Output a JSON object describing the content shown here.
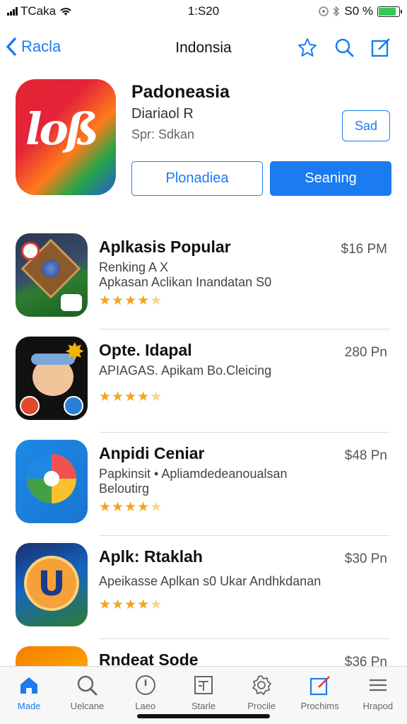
{
  "status_bar": {
    "carrier": "TCaka",
    "time": "1:S20",
    "battery": "S0 %"
  },
  "nav": {
    "back_label": "Racla",
    "title": "Indonsia"
  },
  "hero": {
    "icon_text": "loß",
    "name": "Padoneasia",
    "developer": "Diariaol R",
    "subtitle": "Spr: Sdkan",
    "get_label": "Sad",
    "outline_button": "Plonadiea",
    "filled_button": "Seaning"
  },
  "apps": [
    {
      "name": "Aplkasis Popular",
      "line1": "Renking A X",
      "line2": "Apkasan Aclikan Inandatan S0",
      "price": "$16 PM",
      "rating": 4
    },
    {
      "name": "Opte. Idapal",
      "line1": "APIAGAS. Apikam Bo.Cleicing",
      "line2": "",
      "price": "280 Pn",
      "rating": 4
    },
    {
      "name": "Anpidi Ceniar",
      "line1": "Papkinsit  • Apliamdedeanoualsan",
      "line2": "Beloutirg",
      "price": "$48 Pn",
      "rating": 4
    },
    {
      "name": "Aplk: Rtaklah",
      "line1": "Apeikasse Aplkan s0 Ukar Andhkdanan",
      "line2": "",
      "price": "$30 Pn",
      "rating": 4
    },
    {
      "name": "Rndeat Sode",
      "line1": "",
      "line2": "",
      "price": "$36 Pn",
      "rating": 0
    }
  ],
  "tabs": [
    {
      "label": "Made",
      "icon": "home-icon"
    },
    {
      "label": "Uelcane",
      "icon": "search-icon"
    },
    {
      "label": "Laeo",
      "icon": "clock-icon"
    },
    {
      "label": "Starle",
      "icon": "news-icon"
    },
    {
      "label": "Procile",
      "icon": "gear-icon"
    },
    {
      "label": "Prochims",
      "icon": "edit-icon"
    },
    {
      "label": "Hrapod",
      "icon": "menu-icon"
    }
  ],
  "colors": {
    "accent": "#1a7cf0",
    "star": "#f2a51a"
  }
}
